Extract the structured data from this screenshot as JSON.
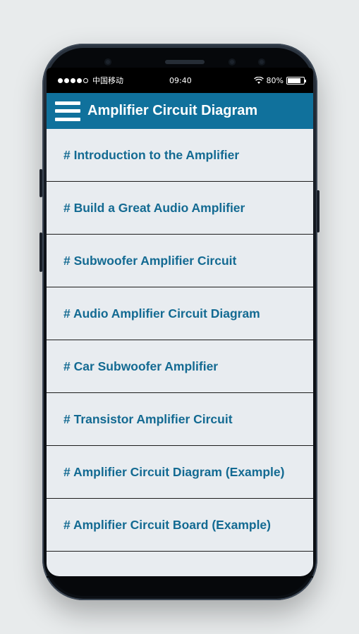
{
  "status_bar": {
    "carrier": "中国移动",
    "time": "09:40",
    "battery": "80%",
    "battery_level": 0.8,
    "signal_bars": 4,
    "signal_max": 5
  },
  "app_bar": {
    "title": "Amplifier Circuit Diagram",
    "menu_icon": "hamburger-menu-icon",
    "color": "#10719c"
  },
  "list": {
    "items": [
      "# Introduction to the Amplifier",
      "# Build a Great Audio Amplifier",
      "# Subwoofer Amplifier Circuit",
      "# Audio Amplifier Circuit Diagram",
      "# Car Subwoofer Amplifier",
      "# Transistor Amplifier Circuit",
      "# Amplifier Circuit Diagram (Example)",
      "# Amplifier Circuit Board (Example)",
      ""
    ],
    "text_color": "#136a92"
  },
  "icons": {
    "wifi": "wifi-icon",
    "battery": "battery-icon",
    "signal": "signal-icon"
  }
}
